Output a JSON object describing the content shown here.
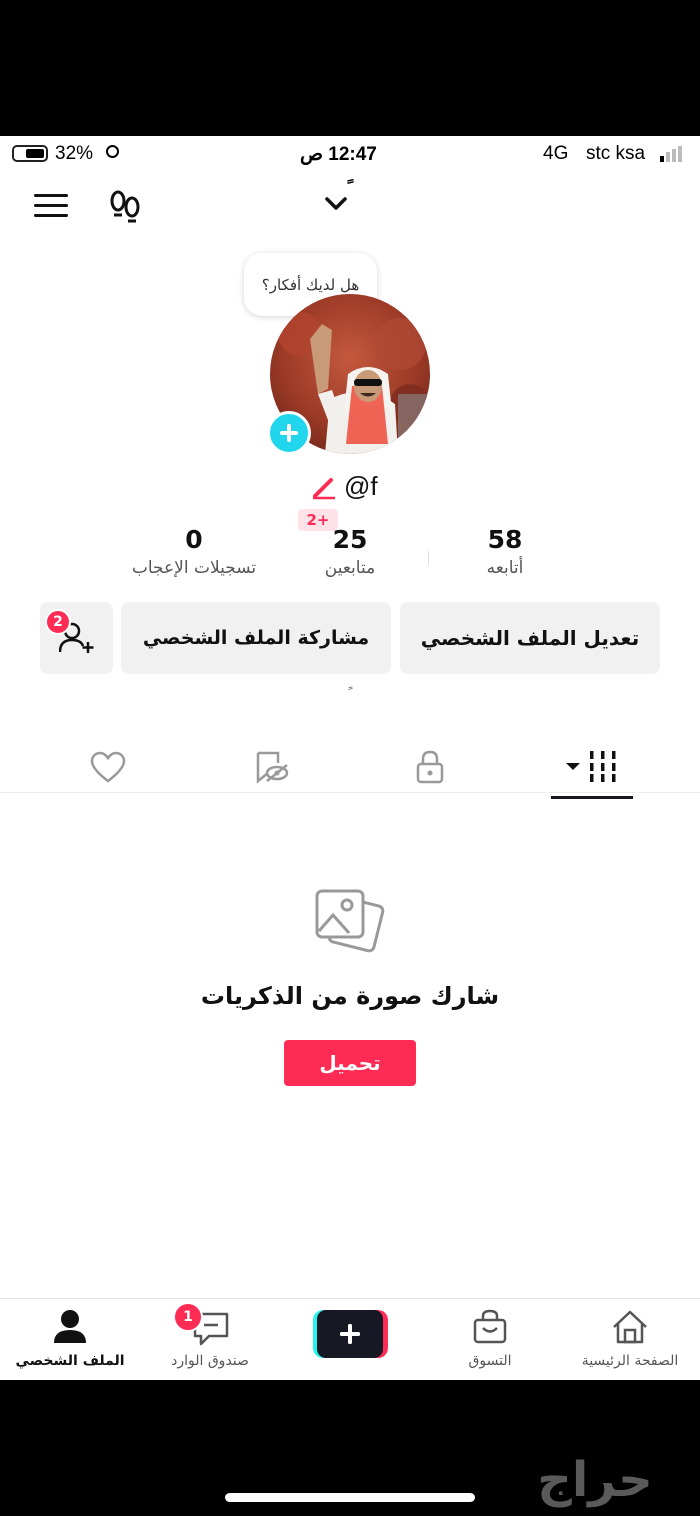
{
  "status_bar": {
    "battery": "32%",
    "time": "12:47 ص",
    "network": "4G",
    "carrier": "stc ksa"
  },
  "header": {
    "title": "ً"
  },
  "profile": {
    "thought_bubble": "هل لديك أفكار؟",
    "username": "@f",
    "new_followers_badge": "2+",
    "stats": {
      "likes_count": "0",
      "likes_label": "تسجيلات الإعجاب",
      "followers_count": "25",
      "followers_label": "متابعين",
      "following_count": "58",
      "following_label": "أتابعه"
    },
    "edit_button": "تعديل الملف الشخصي",
    "share_button": "مشاركة الملف الشخصي",
    "add_friends_badge": "2",
    "bio": "ً"
  },
  "empty_state": {
    "message": "شارك صورة من الذكريات",
    "upload_button": "تحميل"
  },
  "bottom_nav": {
    "home": "الصفحة الرئيسية",
    "shop": "التسوق",
    "inbox": "صندوق الوارد",
    "inbox_badge": "1",
    "profile": "الملف الشخصي"
  },
  "watermark": "حراج",
  "colors": {
    "accent": "#fe2c55",
    "avatar_add": "#20d5ec",
    "button_bg": "#f1f1f2"
  }
}
